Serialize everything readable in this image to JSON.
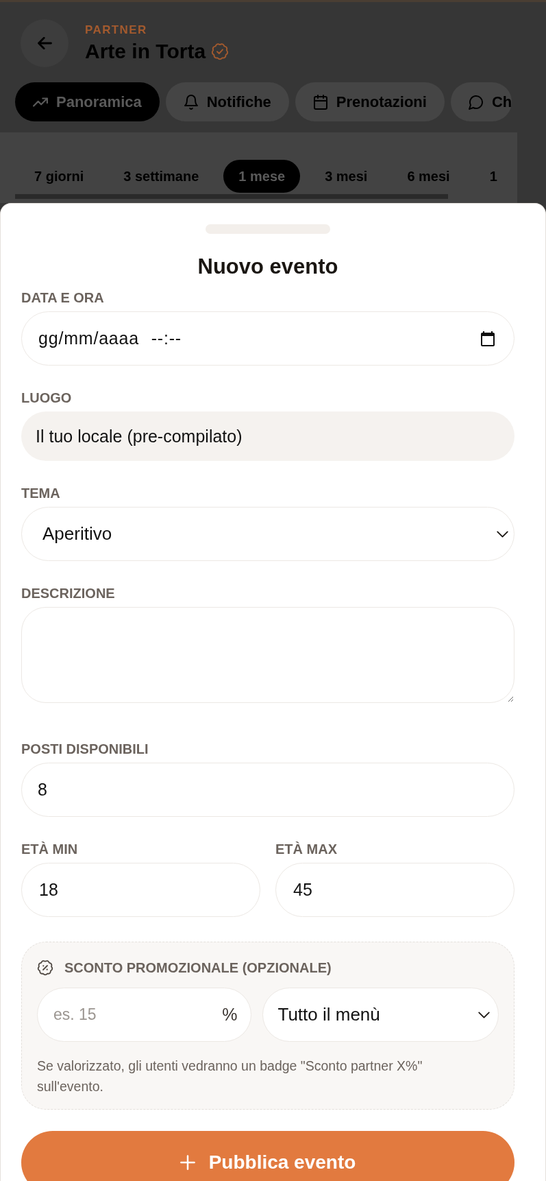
{
  "header": {
    "eyebrow": "PARTNER",
    "title": "Arte in Torta",
    "verified": true
  },
  "tabs": [
    {
      "kind": "overview",
      "label": "Panoramica",
      "selected": true
    },
    {
      "kind": "notifications",
      "label": "Notifiche",
      "selected": false
    },
    {
      "kind": "bookings",
      "label": "Prenotazioni",
      "selected": false
    },
    {
      "kind": "chat",
      "label": "Ch",
      "selected": false
    }
  ],
  "ranges": [
    {
      "label": "7 giorni",
      "selected": false
    },
    {
      "label": "3 settimane",
      "selected": false
    },
    {
      "label": "1 mese",
      "selected": true
    },
    {
      "label": "3 mesi",
      "selected": false
    },
    {
      "label": "6 mesi",
      "selected": false
    },
    {
      "label": "1",
      "selected": false
    }
  ],
  "sheet": {
    "title": "Nuovo evento",
    "fields": [
      {
        "kind": "datetime",
        "label": "DATA E ORA",
        "placeholder": "gg/mm/aaaa --:--"
      },
      {
        "kind": "prefilled",
        "label": "LUOGO",
        "value": "Il tuo locale (pre-compilato)"
      },
      {
        "kind": "select",
        "label": "TEMA",
        "value": "Aperitivo"
      },
      {
        "kind": "textarea",
        "label": "DESCRIZIONE"
      },
      {
        "kind": "number",
        "label": "POSTI DISPONIBILI",
        "value": "8"
      }
    ],
    "age_fields": [
      {
        "label": "ETÀ MIN",
        "value": "18"
      },
      {
        "label": "ETÀ MAX",
        "value": "45"
      }
    ],
    "discount": {
      "title": "SCONTO PROMOZIONALE (OPZIONALE)",
      "placeholder": "es. 15",
      "unit": "%",
      "scope": "Tutto il menù",
      "help": "Se valorizzato, gli utenti vedranno un badge \"Sconto partner X%\" sull'evento."
    },
    "submit": {
      "label": "Pubblica evento"
    }
  }
}
